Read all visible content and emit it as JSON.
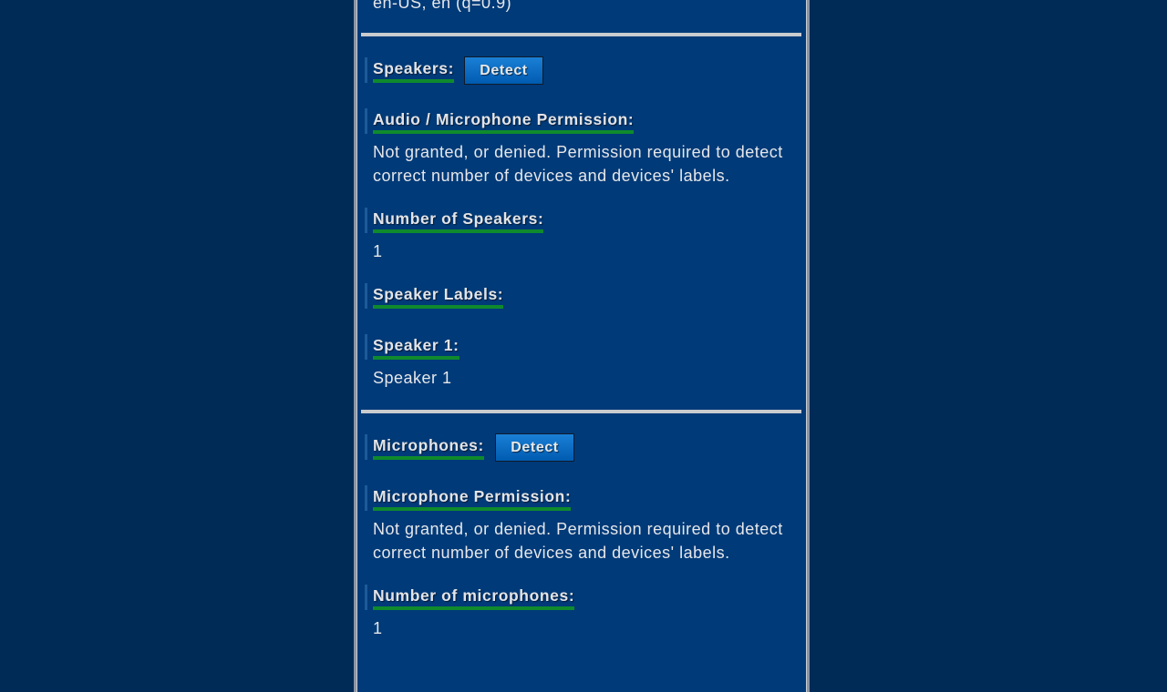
{
  "languages": {
    "value": "en-US, en (q=0.9)"
  },
  "speakers": {
    "heading": "Speakers:",
    "detect_label": "Detect",
    "permission_label": "Audio / Microphone Permission:",
    "permission_line1": "Not granted, or denied. Permission required to detect",
    "permission_line2": "correct number of devices and devices' labels.",
    "count_label": "Number of Speakers:",
    "count_value": "1",
    "labels_heading": "Speaker Labels:",
    "items": [
      {
        "label": "Speaker 1:",
        "value": "Speaker 1"
      }
    ]
  },
  "microphones": {
    "heading": "Microphones:",
    "detect_label": "Detect",
    "permission_label": "Microphone Permission:",
    "permission_line1": "Not granted, or denied. Permission required to detect",
    "permission_line2": "correct number of devices and devices' labels.",
    "count_label": "Number of microphones:",
    "count_value": "1"
  }
}
